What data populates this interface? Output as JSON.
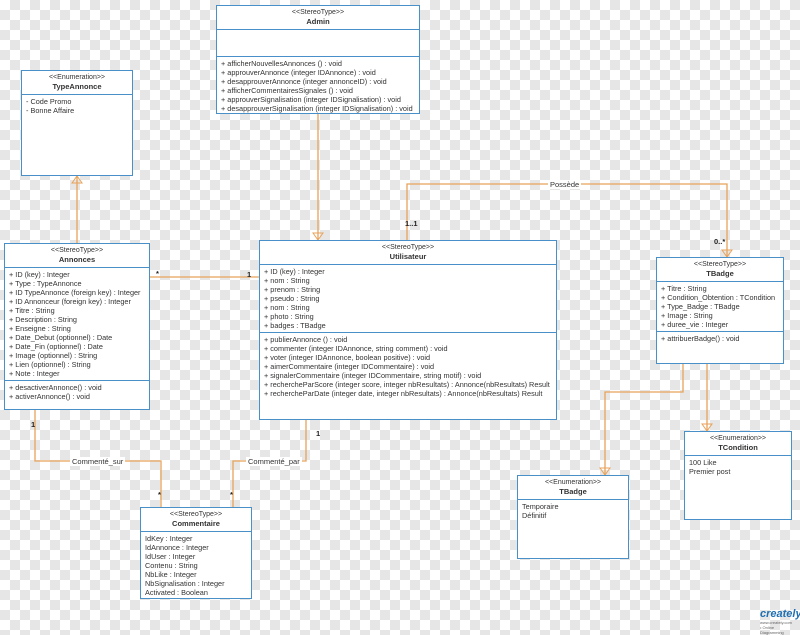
{
  "classes": {
    "admin": {
      "stereotype": "<<StereoType>>",
      "name": "Admin",
      "attributes": [],
      "methods": [
        "+ afficherNouvellesAnnonces () : void",
        "+ approuverAnnonce (integer IDAnnonce) : void",
        "+ desapprouverAnnonce (integer annonceID) : void",
        "+ afficherCommentairesSignales () : void",
        "+ approuverSignalisation (integer IDSignalisation) : void",
        "+ desapprouverSignalisation (integer IDSignalisation) : void"
      ]
    },
    "type_annonce": {
      "stereotype": "<<Enumeration>>",
      "name": "TypeAnnonce",
      "literals": [
        "- Code Promo",
        "- Bonne Affaire"
      ]
    },
    "annonces": {
      "stereotype": "<<StereoType>>",
      "name": "Annonces",
      "attributes": [
        "+ ID (key) : Integer",
        "+ Type : TypeAnnonce",
        "+ ID TypeAnnonce (foreign key) : Integer",
        "+ ID Annonceur (foreign key) : Integer",
        "+ Titre  : String",
        "+ Description  : String",
        "+ Enseigne : String",
        "+ Date_Debut (optionnel) : Date",
        "+ Date_Fin (optionnel) : Date",
        "+ Image (optionnel) : String",
        "+ Lien (optionnel) : String",
        "+ Note : Integer"
      ],
      "methods": [
        "+ desactiverAnnonce() : void",
        "+ activerAnnonce() : void"
      ]
    },
    "utilisateur": {
      "stereotype": "<<StereoType>>",
      "name": "Utilisateur",
      "attributes": [
        "+ ID (key) : Integer",
        "+ nom : String",
        "+ prenom : String",
        "+ pseudo : String",
        "+ nom : String",
        "+ photo : String",
        "+ badges : TBadge"
      ],
      "methods": [
        "+ publierAnnonce () : void",
        "+ commenter (integer IDAnnonce, string comment) : void",
        "+ voter (integer IDAnnonce, boolean positive) : void",
        "+ aimerCommentaire (integer IDCommentaire) : void",
        "+ signalerCommentaire (integer IDCommentaire, string motif) : void",
        "+ rechercheParScore (integer score, integer nbResultats) : Annonce(nbResultats) Result",
        "+ rechercheParDate (integer date, integer nbResultats) : Annonce(nbResultats) Result"
      ]
    },
    "tbadge": {
      "stereotype": "<<StereoType>>",
      "name": "TBadge",
      "attributes": [
        "+ Titre : String",
        "+ Condition_Obtention : TCondition",
        "+ Type_Badge : TBadge",
        "+ Image : String",
        "+ duree_vie : Integer"
      ],
      "methods": [
        "+ attribuerBadge() : void"
      ]
    },
    "commentaire": {
      "stereotype": "<<StereoType>>",
      "name": "Commentaire",
      "attributes": [
        "IdKey : Integer",
        "IdAnnonce : Integer",
        "IdUser : Integer",
        "Contenu : String",
        "NbLike : Integer",
        "NbSignalisation : Integer",
        "Activated : Boolean"
      ]
    },
    "tcondition": {
      "stereotype": "<<Enumeration>>",
      "name": "TCondition",
      "literals": [
        "100 Like",
        "Premier post"
      ]
    },
    "tbadge_enum": {
      "stereotype": "<<Enumeration>>",
      "name": "TBadge",
      "literals": [
        "Temporaire",
        "Définitif"
      ]
    }
  },
  "associations": {
    "possede_label": "Possède",
    "commente_sur_label": "Commenté_sur",
    "commente_par_label": "Commenté_par"
  },
  "multiplicities": {
    "annonces_side": "*",
    "utilisateur_annonces_side": "1",
    "utilisateur_possede_side": "1..1",
    "tbadge_possede_side": "0..*",
    "annonces_comment_side": "1",
    "commentaire_sur_side": "*",
    "utilisateur_comment_side": "1",
    "commentaire_par_side": "*"
  },
  "watermark": {
    "text": "creately",
    "subtext": "www.creately.com • Online Diagramming"
  },
  "colors": {
    "box_border": "#4a90c8",
    "connector": "#e8a25a",
    "background_check": "#e6e6e6"
  }
}
